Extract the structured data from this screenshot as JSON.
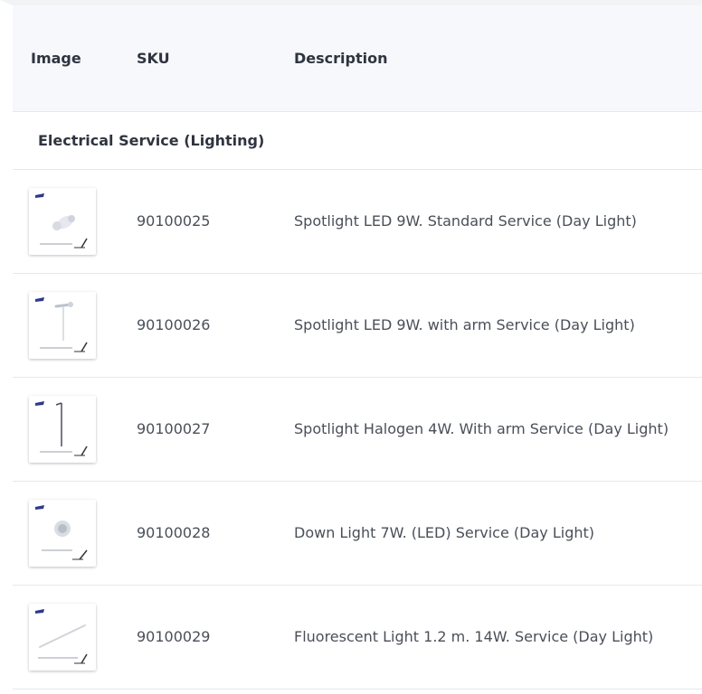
{
  "table": {
    "headers": {
      "image": "Image",
      "sku": "SKU",
      "description": "Description"
    },
    "group": "Electrical Service (Lighting)",
    "rows": [
      {
        "sku": "90100025",
        "description": "Spotlight LED 9W. Standard Service (Day Light)",
        "thumb_icon": "spotlight-standard-icon"
      },
      {
        "sku": "90100026",
        "description": "Spotlight LED 9W. with arm Service (Day Light)",
        "thumb_icon": "spotlight-arm-icon"
      },
      {
        "sku": "90100027",
        "description": "Spotlight Halogen 4W. With arm Service (Day Light)",
        "thumb_icon": "halogen-arm-icon"
      },
      {
        "sku": "90100028",
        "description": "Down Light 7W. (LED) Service (Day Light)",
        "thumb_icon": "downlight-icon"
      },
      {
        "sku": "90100029",
        "description": "Fluorescent Light 1.2 m. 14W. Service (Day Light)",
        "thumb_icon": "fluorescent-tube-icon"
      }
    ]
  },
  "colors": {
    "header_bg": "#f6f8fb",
    "border": "#e6e8ec",
    "badge": "#2b3a8c"
  }
}
